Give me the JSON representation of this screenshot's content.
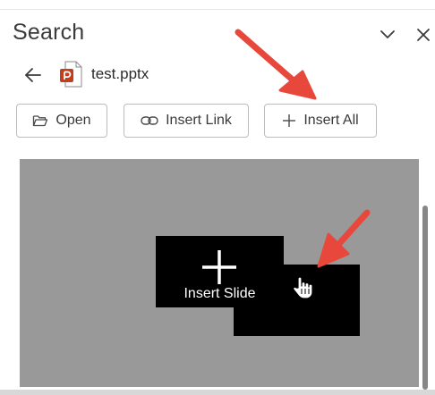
{
  "pane": {
    "title": "Search",
    "collapse_icon": "chevron-down-icon",
    "close_icon": "close-icon"
  },
  "file": {
    "back_icon": "arrow-left-icon",
    "type_icon": "powerpoint-file-icon",
    "name": "test.pptx"
  },
  "toolbar": {
    "open_label": "Open",
    "open_icon": "folder-open-icon",
    "insert_link_label": "Insert Link",
    "insert_link_icon": "link-icon",
    "insert_all_label": "Insert All",
    "insert_all_icon": "plus-icon"
  },
  "preview": {
    "insert_slide_label": "Insert Slide",
    "insert_slide_icon": "plus-icon",
    "cursor_icon": "hand-pointer-icon"
  },
  "colors": {
    "annotation_arrow": "#e8483b",
    "powerpoint_brand": "#c43e1c",
    "preview_background": "#999999",
    "slide_thumbnail": "#000000"
  }
}
